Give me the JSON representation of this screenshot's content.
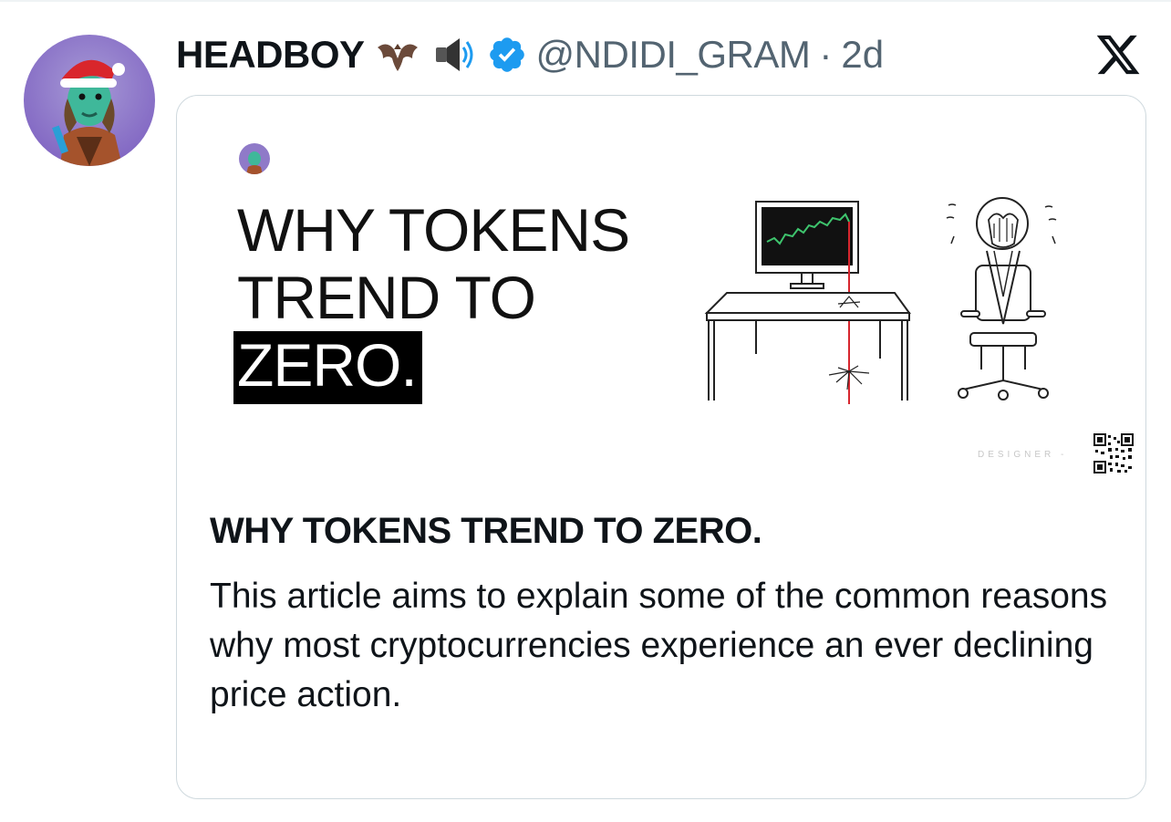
{
  "tweet": {
    "display_name": "HEADBOY",
    "handle": "@NDIDI_GRAM",
    "separator": "·",
    "time": "2d",
    "verified": true,
    "emojis": [
      "bat-emoji",
      "speaker-emoji"
    ]
  },
  "card": {
    "image": {
      "headline_lines": [
        "WHY TOKENS",
        "TREND TO"
      ],
      "headline_highlight": "ZERO.",
      "footer_text": "DESIGNER -"
    },
    "title": "WHY TOKENS TREND TO ZERO.",
    "description": "This article aims to explain some of the common reasons why most cryptocurrencies experience an ever declining price action."
  },
  "colors": {
    "text_primary": "#0f1419",
    "text_secondary": "#536471",
    "verified_blue": "#1d9bf0",
    "border": "#cfd9de"
  },
  "icons": [
    "x-logo-icon",
    "verified-badge-icon"
  ]
}
